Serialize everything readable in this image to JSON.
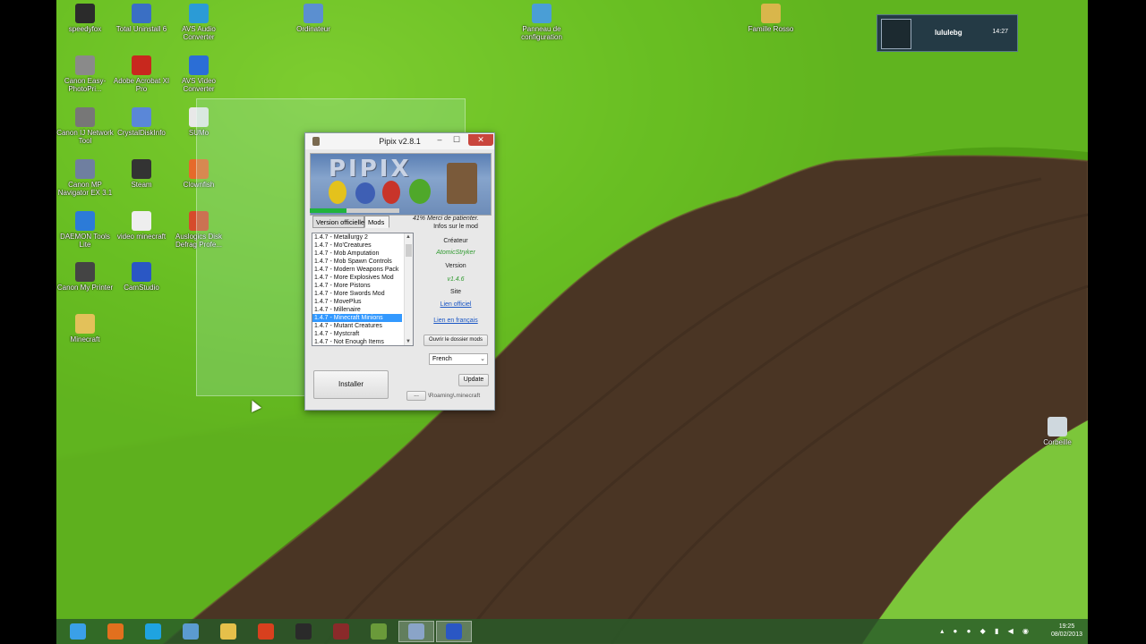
{
  "desktop": {
    "icons": [
      {
        "label": "speedyfox",
        "color": "#2b2b2b"
      },
      {
        "label": "Total Uninstall 6",
        "color": "#3a6fc4"
      },
      {
        "label": "AVS Audio Converter",
        "color": "#2b9bd6"
      },
      {
        "label": "Ordinateur",
        "color": "#5b8fd0"
      },
      {
        "label": "Panneau de configuration",
        "color": "#4a9ed6"
      },
      {
        "label": "Famille Rosso",
        "color": "#d9b64b"
      },
      {
        "label": "Canon Easy-PhotoPri...",
        "color": "#8a8a8a"
      },
      {
        "label": "Adobe Acrobat XI Pro",
        "color": "#c8281e"
      },
      {
        "label": "AVS Video Converter",
        "color": "#2b6ed6"
      },
      {
        "label": "Canon IJ Network Tool",
        "color": "#777"
      },
      {
        "label": "CrystalDiskInfo",
        "color": "#5a87d8"
      },
      {
        "label": "SUMo",
        "color": "#e8e8e8"
      },
      {
        "label": "Canon MP Navigator EX 3.1",
        "color": "#6f7fa0"
      },
      {
        "label": "Steam",
        "color": "#333"
      },
      {
        "label": "Clownfish",
        "color": "#e66a2a"
      },
      {
        "label": "DAEMON Tools Lite",
        "color": "#2c7bd8"
      },
      {
        "label": "video minecraft",
        "color": "#eee"
      },
      {
        "label": "Auslogics Disk Defrag Profe...",
        "color": "#d64b2b"
      },
      {
        "label": "Canon My Printer",
        "color": "#444"
      },
      {
        "label": "CamStudio",
        "color": "#2a57c4"
      },
      {
        "label": "Minecraft",
        "color": "#e3c15a"
      },
      {
        "label": "Corbeille",
        "color": "#cfd8de"
      }
    ]
  },
  "notification": {
    "user": "lululebg",
    "time": "14:27"
  },
  "window": {
    "title": "Pipix v2.8.1",
    "min_glyph": "–",
    "max_glyph": "☐",
    "close_glyph": "✕",
    "banner_logo": "PIPIX",
    "progress_value": 0.41,
    "progress_text": "41% Merci de patienter.",
    "tabs": [
      "Version officielle",
      "Mods"
    ],
    "mods": [
      "1.4.7 - Metallurgy 2",
      "1.4.7 - Mo'Creatures",
      "1.4.7 - Mob Amputation",
      "1.4.7 - Mob Spawn Controls",
      "1.4.7 - Modern Weapons Pack",
      "1.4.7 - More Explosives Mod",
      "1.4.7 - More Pistons",
      "1.4.7 - More Swords Mod",
      "1.4.7 - MovePlus",
      "1.4.7 - Millenaire",
      "1.4.7 - Minecraft Minions",
      "1.4.7 - Mutant Creatures",
      "1.4.7 - Mystcraft",
      "1.4.7 - Not Enough Items"
    ],
    "selected_index": 10,
    "info": {
      "header": "Infos sur le mod",
      "creator_label": "Créateur",
      "creator_value": "AtomicStryker",
      "version_label": "Version",
      "version_value": "v1.4.6",
      "site_label": "Site",
      "official_link": "Lien officiel",
      "french_link": "Lien en français"
    },
    "open_folder_button": "Ouvrir le dossier mods",
    "language": "French",
    "install_button": "Installer",
    "update_button": "Update",
    "browse_button": "...",
    "path": "\\Roaming\\.minecraft"
  },
  "taskbar": {
    "items": [
      {
        "name": "start",
        "color": "#3aa0e8"
      },
      {
        "name": "firefox",
        "color": "#e2701e"
      },
      {
        "name": "skype",
        "color": "#1fa3e0"
      },
      {
        "name": "network",
        "color": "#5b9bd0"
      },
      {
        "name": "explorer",
        "color": "#e5c04a"
      },
      {
        "name": "browser",
        "color": "#d8401e"
      },
      {
        "name": "steam",
        "color": "#2a2a2a"
      },
      {
        "name": "game",
        "color": "#8a2a2a"
      },
      {
        "name": "minecraft",
        "color": "#6a9a3a"
      },
      {
        "name": "pipix",
        "color": "#8aa4c8"
      },
      {
        "name": "camstudio",
        "color": "#2a57c4"
      }
    ],
    "clock_time": "19:25",
    "clock_date": "08/02/2013"
  }
}
